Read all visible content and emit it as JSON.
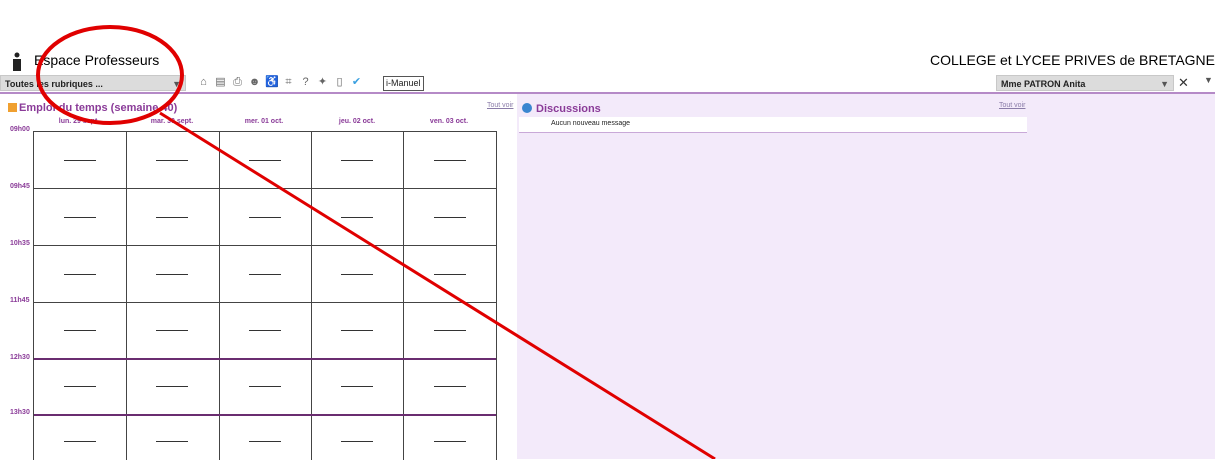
{
  "header": {
    "title": "Espace Professeurs",
    "school": "COLLEGE et LYCEE PRIVES de BRETAGNE"
  },
  "toolbar": {
    "rubriques": "Toutes les rubriques ...",
    "imanuel": "i-Manuel",
    "user": "Mme PATRON Anita",
    "icons": [
      "home-icon",
      "calendar-icon",
      "print-icon",
      "people-icon",
      "accessibility-icon",
      "grid-icon",
      "help-icon",
      "tips-icon",
      "mobile-icon",
      "twitter-icon"
    ]
  },
  "schedule": {
    "title": "Emploi du temps (semaine 40)",
    "see_all": "Tout voir",
    "days": [
      "lun. 29 sept.",
      "mar. 30 sept.",
      "mer. 01 oct.",
      "jeu. 02 oct.",
      "ven. 03 oct."
    ],
    "times": [
      "09h00",
      "09h45",
      "10h35",
      "11h45",
      "12h30",
      "13h30"
    ]
  },
  "discussions": {
    "title": "Discussions",
    "see_all": "Tout voir",
    "message": "Aucun nouveau message"
  },
  "colors": {
    "accent": "#8a3b98",
    "panel_bg": "#f3eafa",
    "annotation": "#e00000"
  }
}
